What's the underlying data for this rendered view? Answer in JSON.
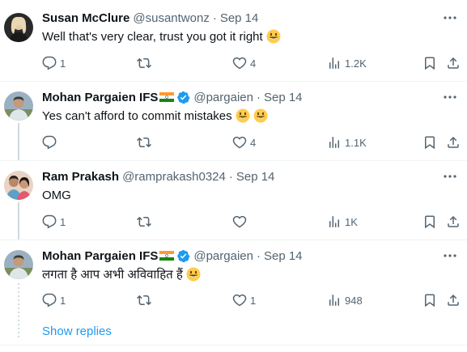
{
  "tweets": [
    {
      "name": "Susan McClure",
      "handle": "@susantwonz",
      "dot": "·",
      "time": "Sep 14",
      "text": "Well that's very clear, trust you got it right",
      "emojis": 1,
      "verified": false,
      "flag": false,
      "replies": "1",
      "retweets": "",
      "likes": "4",
      "views": "1.2K"
    },
    {
      "name": "Mohan Pargaien IFS",
      "handle": "@pargaien",
      "dot": "·",
      "time": "Sep 14",
      "text": "Yes can't afford to commit mistakes",
      "emojis": 2,
      "verified": true,
      "flag": true,
      "replies": "",
      "retweets": "",
      "likes": "4",
      "views": "1.1K"
    },
    {
      "name": "Ram Prakash",
      "handle": "@ramprakash0324",
      "dot": "·",
      "time": "Sep 14",
      "text": "OMG",
      "emojis": 0,
      "verified": false,
      "flag": false,
      "replies": "1",
      "retweets": "",
      "likes": "",
      "views": "1K"
    },
    {
      "name": "Mohan Pargaien IFS",
      "handle": "@pargaien",
      "dot": "·",
      "time": "Sep 14",
      "text": "लगता है आप अभी अविवाहित हैं",
      "emojis": 1,
      "verified": true,
      "flag": true,
      "replies": "1",
      "retweets": "",
      "likes": "1",
      "views": "948"
    }
  ],
  "show_replies_label": "Show replies",
  "colors": {
    "text": "#0f1419",
    "secondary": "#536471",
    "accent": "#1d9bf0",
    "divider": "#eff3f4",
    "thread_line": "#cfd9de"
  },
  "icons": [
    "more-icon",
    "reply-icon",
    "retweet-icon",
    "like-icon",
    "views-icon",
    "bookmark-icon",
    "share-icon",
    "verified-icon",
    "india-flag-icon",
    "smiley-emoji-icon"
  ]
}
